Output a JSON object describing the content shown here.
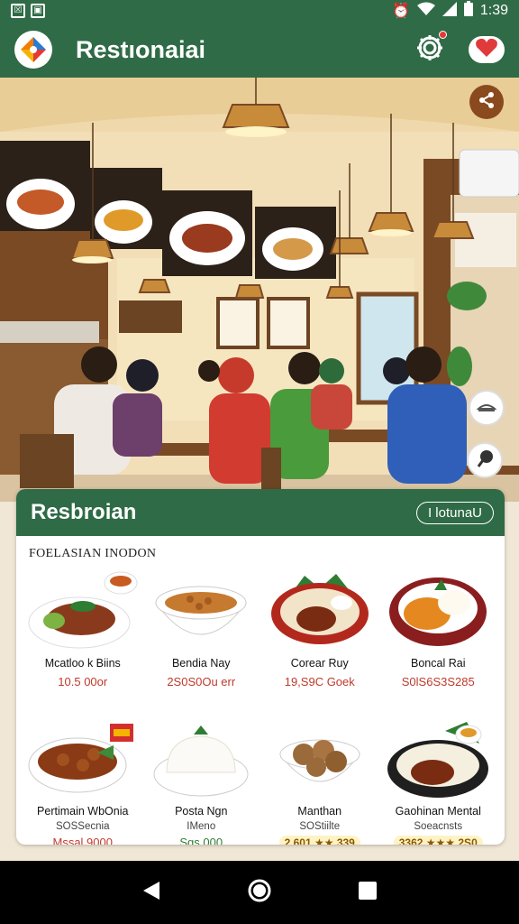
{
  "status": {
    "time": "1:39"
  },
  "app": {
    "title": "Restıonaiai"
  },
  "card": {
    "title": "Resbroian",
    "pill": "I lotunaU",
    "section": "FOELASIAN INODON",
    "items": [
      {
        "name": "Mcatloo k Biins",
        "price": "10.5 00or"
      },
      {
        "name": "Bendia Nay",
        "price": "2S0S0Ou err"
      },
      {
        "name": "Corear Ruy",
        "price": "19,S9C Goek"
      },
      {
        "name": "Boncal Rai",
        "price": "S0lS6S3S285"
      },
      {
        "name": "Pertimain WbOnia",
        "sub": "SOSSecnia",
        "price": "Mssal 9000"
      },
      {
        "name": "Posta Ngn",
        "sub": "IMeno",
        "price": "Sgs 000"
      },
      {
        "name": "Manthan",
        "sub": "SOStiilte",
        "rating": "2.601 ★★ 339"
      },
      {
        "name": "Gaohinan Mental",
        "sub": "Soeacnsts",
        "rating": "3362 ★★★ 2S0"
      }
    ]
  },
  "colors": {
    "primary": "#2f6b46",
    "accent": "#c0392b",
    "star": "#f4b400"
  },
  "icons": [
    "app-logo-icon",
    "settings-gear-icon",
    "heart-icon",
    "share-icon",
    "cake-icon",
    "chat-icon",
    "back-icon",
    "home-icon",
    "recents-icon"
  ]
}
